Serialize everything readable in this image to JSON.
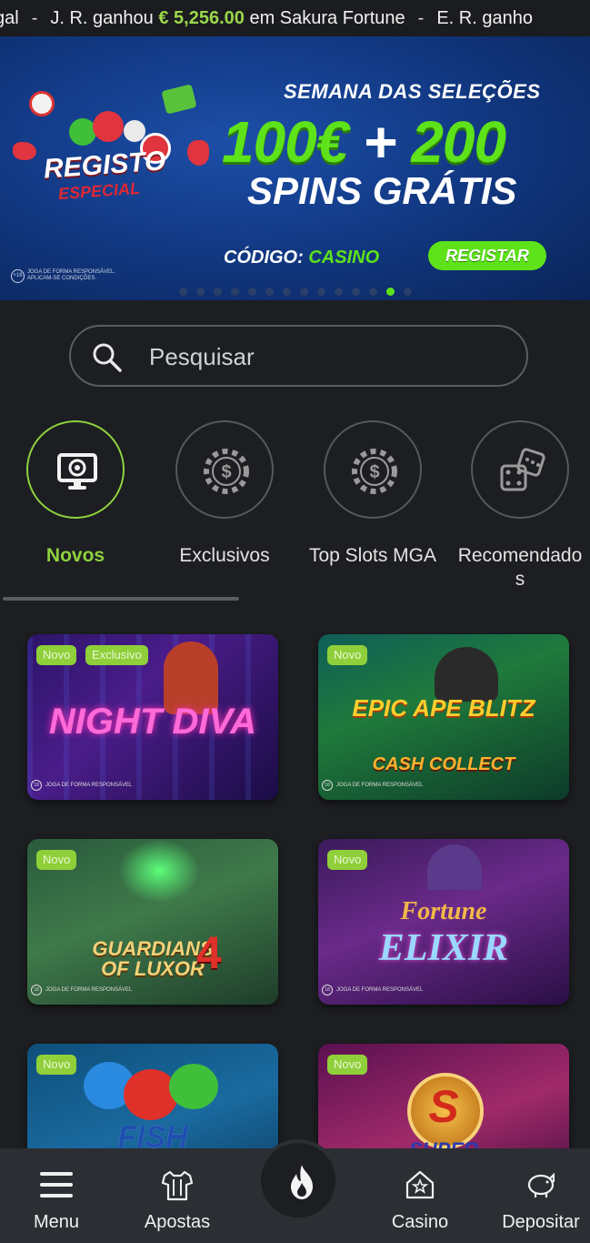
{
  "ticker": {
    "lead": "gal",
    "sep": "-",
    "item1_prefix": "J. R. ganhou",
    "item1_amount": "€ 5,256.00",
    "item1_suffix": "em Sakura Fortune",
    "item2": "E. R. ganho"
  },
  "banner": {
    "badge_line1": "REGISTO",
    "badge_line2": "ESPECIAL",
    "headline": "SEMANA DAS SELEÇÕES",
    "amount": "100€",
    "plus": "+",
    "spins_count": "200",
    "spins_label": "SPINS GRÁTIS",
    "code_label": "CÓDIGO:",
    "code_value": "CASINO",
    "register_label": "REGISTAR",
    "responsible_badge": "+18",
    "responsible_text": "JOGA DE FORMA RESPONSÁVEL. APLICAM-SE CONDIÇÕES.",
    "slide_count": 14,
    "active_slide": 12,
    "accent_color": "#5ee21a"
  },
  "search": {
    "placeholder": "Pesquisar",
    "icon": "search-icon"
  },
  "categories": [
    {
      "label": "Novos",
      "icon": "monitor-chip-icon",
      "active": true
    },
    {
      "label": "Exclusivos",
      "icon": "casino-chip-icon",
      "active": false
    },
    {
      "label": "Top Slots MGA",
      "icon": "casino-chip-icon",
      "active": false
    },
    {
      "label": "Recomendado\ns",
      "icon": "dice-icon",
      "active": false
    }
  ],
  "games": [
    {
      "title": "NIGHT DIVA",
      "badges": [
        "Novo",
        "Exclusivo"
      ],
      "responsible": "JOGA DE FORMA RESPONSÁVEL"
    },
    {
      "title": "EPIC APE BLITZ",
      "subtitle": "CASH COLLECT",
      "badges": [
        "Novo"
      ],
      "responsible": "JOGA DE FORMA RESPONSÁVEL"
    },
    {
      "title": "GUARDIANS",
      "subtitle": "OF LUXOR",
      "number": "4",
      "badges": [
        "Novo"
      ],
      "responsible": "JOGA DE FORMA RESPONSÁVEL"
    },
    {
      "title": "Fortune",
      "subtitle": "ELIXIR",
      "badges": [
        "Novo"
      ],
      "responsible": "JOGA DE FORMA RESPONSÁVEL"
    },
    {
      "title": "FISH",
      "badges": [
        "Novo"
      ]
    },
    {
      "title": "S",
      "subtitle": "SUPER",
      "badges": [
        "Novo"
      ]
    }
  ],
  "nav": {
    "menu": "Menu",
    "bets": "Apostas",
    "casino": "Casino",
    "deposit": "Depositar",
    "fab_icon": "flame-icon"
  }
}
